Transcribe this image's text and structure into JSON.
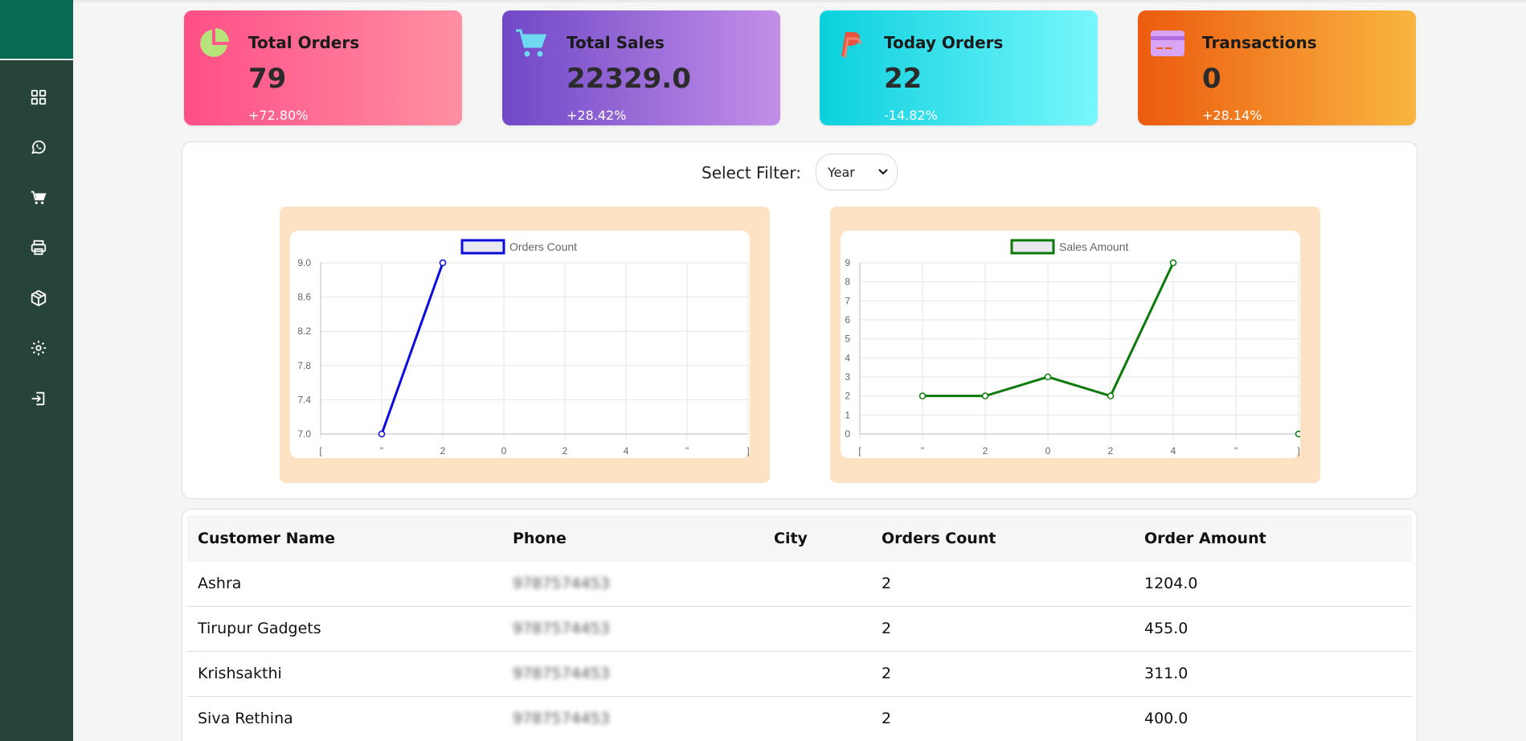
{
  "sidebar": {
    "icons": [
      "grid-icon",
      "whatsapp-icon",
      "cart-icon",
      "printer-icon",
      "box-icon",
      "settings-icon",
      "logout-icon"
    ]
  },
  "cards": [
    {
      "title": "Total Orders",
      "value": "79",
      "change": "+72.80%",
      "icon": "pie-chart-icon"
    },
    {
      "title": "Total Sales",
      "value": "22329.0",
      "change": "+28.42%",
      "icon": "cart-icon"
    },
    {
      "title": "Today Orders",
      "value": "22",
      "change": "-14.82%",
      "icon": "paypal-icon"
    },
    {
      "title": "Transactions",
      "value": "0",
      "change": "+28.14%",
      "icon": "credit-card-icon"
    }
  ],
  "filter": {
    "label": "Select Filter:",
    "value": "Year"
  },
  "chart_data": [
    {
      "type": "line",
      "series": [
        {
          "name": "Orders Count",
          "values": [
            7.0,
            9.0
          ]
        }
      ],
      "x": [
        "[",
        "\"",
        "2",
        "0",
        "2",
        "4",
        "\"",
        "]"
      ],
      "x_points": [
        "\"",
        "2"
      ],
      "ylim": [
        7.0,
        9.0
      ],
      "yticks": [
        "9.0",
        "8.6",
        "8.2",
        "7.8",
        "7.4",
        "7.0"
      ],
      "color": "#0b0bdc",
      "grid": true,
      "legend": "top"
    },
    {
      "type": "line",
      "series": [
        {
          "name": "Sales Amount",
          "values": [
            2,
            2,
            3,
            2,
            9,
            null,
            0
          ]
        }
      ],
      "x": [
        "[",
        "\"",
        "2",
        "0",
        "2",
        "4",
        "\"",
        "]"
      ],
      "ylim": [
        0,
        9
      ],
      "yticks": [
        "9",
        "8",
        "7",
        "6",
        "5",
        "4",
        "3",
        "2",
        "1",
        "0"
      ],
      "color": "#0b7a0b",
      "grid": true,
      "legend": "top"
    }
  ],
  "table": {
    "headers": [
      "Customer Name",
      "Phone",
      "City",
      "Orders Count",
      "Order Amount"
    ],
    "rows": [
      {
        "name": "Ashra",
        "phone": "9787574453",
        "city": "",
        "count": "2",
        "amount": "1204.0"
      },
      {
        "name": "Tirupur Gadgets",
        "phone": "9787574453",
        "city": "",
        "count": "2",
        "amount": "455.0"
      },
      {
        "name": "Krishsakthi",
        "phone": "9787574453",
        "city": "",
        "count": "2",
        "amount": "311.0"
      },
      {
        "name": "Siva Rethina",
        "phone": "9787574453",
        "city": "",
        "count": "2",
        "amount": "400.0"
      }
    ]
  }
}
